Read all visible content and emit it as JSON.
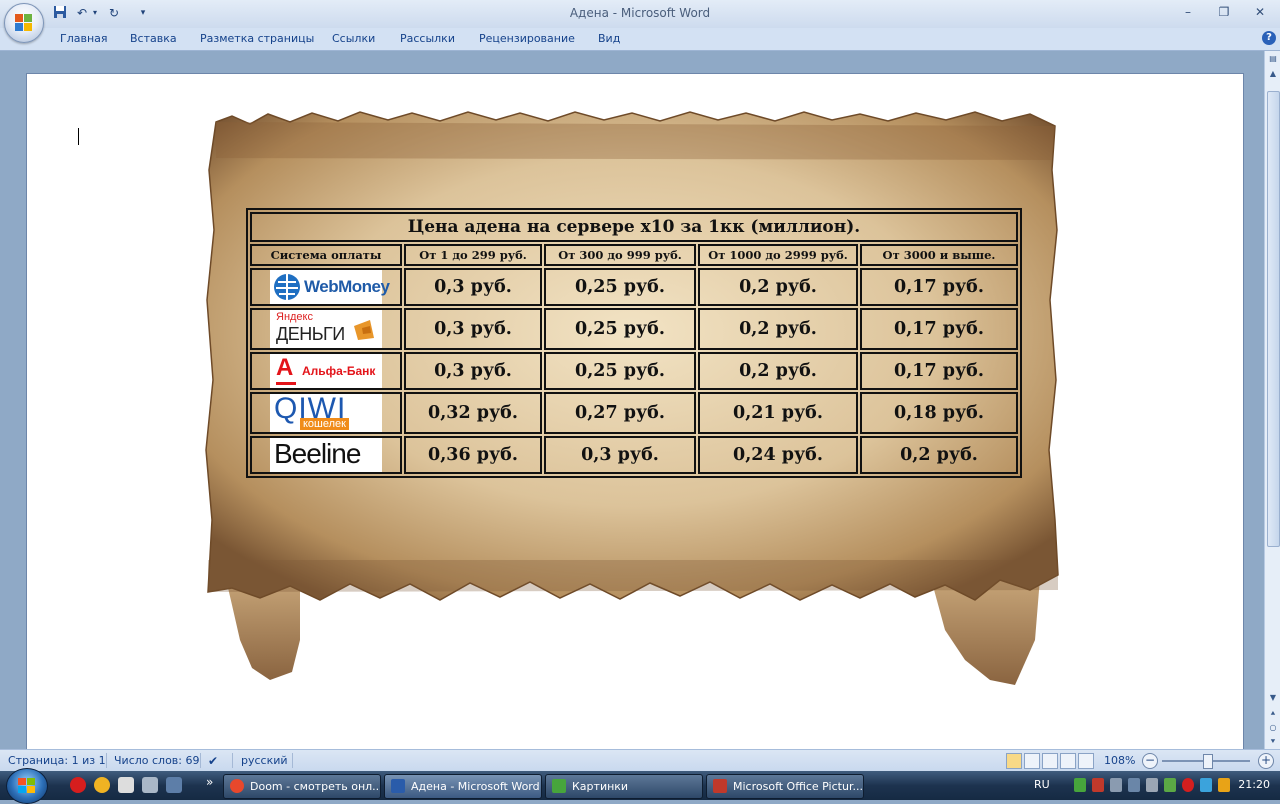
{
  "window": {
    "title": "Адена - Microsoft Word",
    "controls": {
      "minimize": "–",
      "maximize": "❐",
      "close": "✕"
    }
  },
  "quick_access": {
    "save_icon": "save-icon",
    "undo_icon": "undo-icon",
    "redo_icon": "redo-icon",
    "customize_icon": "chevron-down-icon"
  },
  "ribbon": {
    "tabs": [
      "Главная",
      "Вставка",
      "Разметка страницы",
      "Ссылки",
      "Рассылки",
      "Рецензирование",
      "Вид"
    ],
    "help": "?"
  },
  "document": {
    "table": {
      "caption": "Цена адена на сервере х10 за 1кк (миллион).",
      "headers": [
        "Система оплаты",
        "От 1 до 299 руб.",
        "От 300 до 999 руб.",
        "От 1000 до 2999 руб.",
        "От 3000 и выше."
      ],
      "rows": [
        {
          "system": "WebMoney",
          "logo_lines": [
            "WebMoney"
          ],
          "prices": [
            "0,3 руб.",
            "0,25 руб.",
            "0,2 руб.",
            "0,17 руб."
          ]
        },
        {
          "system": "Яндекс Деньги",
          "logo_lines": [
            "Яндекс",
            "ДЕНЬГИ"
          ],
          "prices": [
            "0,3 руб.",
            "0,25 руб.",
            "0,2 руб.",
            "0,17 руб."
          ]
        },
        {
          "system": "Альфа-Банк",
          "logo_lines": [
            "А",
            "Альфа-Банк"
          ],
          "prices": [
            "0,3 руб.",
            "0,25 руб.",
            "0,2 руб.",
            "0,17 руб."
          ]
        },
        {
          "system": "QIWI кошелек",
          "logo_lines": [
            "QIWI",
            "кошелек"
          ],
          "prices": [
            "0,32 руб.",
            "0,27 руб.",
            "0,21 руб.",
            "0,18 руб."
          ]
        },
        {
          "system": "Beeline",
          "logo_lines": [
            "Beeline"
          ],
          "prices": [
            "0,36 руб.",
            "0,3 руб.",
            "0,24 руб.",
            "0,2 руб."
          ]
        }
      ]
    }
  },
  "statusbar": {
    "page": "Страница: 1 из 1",
    "words": "Число слов: 69",
    "language": "русский",
    "zoom": "108%",
    "zoom_minus": "−",
    "zoom_plus": "+"
  },
  "taskbar": {
    "tasks": [
      {
        "label": "Doom - смотреть онл...",
        "icon_color": "#e8482c"
      },
      {
        "label": "Адена - Microsoft Word",
        "icon_color": "#2a5caa"
      },
      {
        "label": "Картинки",
        "icon_color": "#47a53c"
      },
      {
        "label": "Microsoft Office Pictur...",
        "icon_color": "#c0392b"
      }
    ],
    "expand": "»",
    "language": "RU",
    "clock": "21:20"
  }
}
